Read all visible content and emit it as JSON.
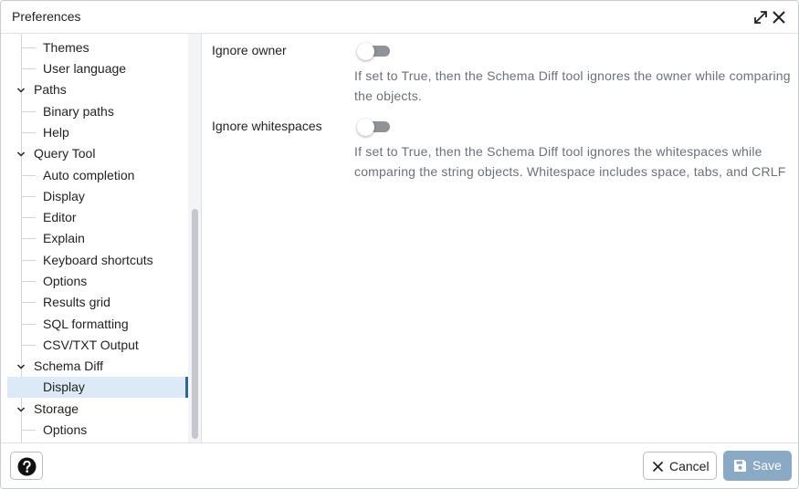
{
  "dialog": {
    "title": "Preferences"
  },
  "sidebar": {
    "items": [
      {
        "label": "Themes",
        "kind": "child"
      },
      {
        "label": "User language",
        "kind": "child"
      },
      {
        "label": "Paths",
        "kind": "parent"
      },
      {
        "label": "Binary paths",
        "kind": "child"
      },
      {
        "label": "Help",
        "kind": "child"
      },
      {
        "label": "Query Tool",
        "kind": "parent"
      },
      {
        "label": "Auto completion",
        "kind": "child"
      },
      {
        "label": "Display",
        "kind": "child"
      },
      {
        "label": "Editor",
        "kind": "child"
      },
      {
        "label": "Explain",
        "kind": "child"
      },
      {
        "label": "Keyboard shortcuts",
        "kind": "child"
      },
      {
        "label": "Options",
        "kind": "child"
      },
      {
        "label": "Results grid",
        "kind": "child"
      },
      {
        "label": "SQL formatting",
        "kind": "child"
      },
      {
        "label": "CSV/TXT Output",
        "kind": "child"
      },
      {
        "label": "Schema Diff",
        "kind": "parent"
      },
      {
        "label": "Display",
        "kind": "child",
        "selected": true
      },
      {
        "label": "Storage",
        "kind": "parent"
      },
      {
        "label": "Options",
        "kind": "child"
      }
    ]
  },
  "preferences": [
    {
      "label": "Ignore owner",
      "value": false,
      "help": "If set to True, then the Schema Diff tool ignores the owner while comparing the objects."
    },
    {
      "label": "Ignore whitespaces",
      "value": false,
      "help": "If set to True, then the Schema Diff tool ignores the whitespaces while comparing the string objects. Whitespace includes space, tabs, and CRLF"
    }
  ],
  "footer": {
    "cancel_label": "Cancel",
    "save_label": "Save"
  },
  "colors": {
    "selected_bg": "#dbeaf6",
    "selected_accent": "#326690",
    "save_button": "#8aa9c4",
    "help_text": "#6b7079"
  }
}
